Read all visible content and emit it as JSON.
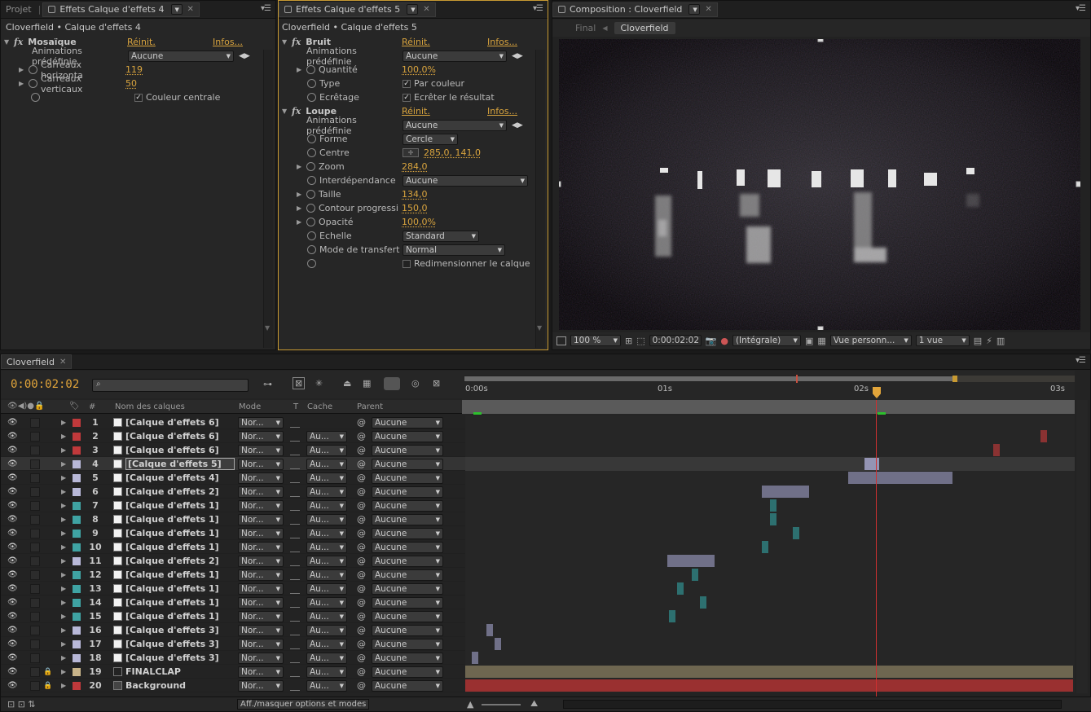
{
  "panel_left": {
    "tab_inactive": "Projet",
    "tab_active": "Effets Calque d'effets 4",
    "breadcrumb": "Cloverfield • Calque d'effets 4",
    "effect": {
      "name": "Mosaïque",
      "reset": "Réinit.",
      "info": "Infos...",
      "props": [
        {
          "label": "Animations prédéfinie",
          "value": "Aucune"
        },
        {
          "label": "Carreaux horizonta",
          "value": "119"
        },
        {
          "label": "Carreaux verticaux",
          "value": "50"
        },
        {
          "label": "",
          "value": "Couleur centrale"
        }
      ]
    }
  },
  "panel_mid": {
    "tab_active": "Effets Calque d'effets 5",
    "breadcrumb": "Cloverfield • Calque d'effets 5",
    "effect1": {
      "name": "Bruit",
      "reset": "Réinit.",
      "info": "Infos...",
      "props": [
        {
          "label": "Animations prédéfinie",
          "value": "Aucune"
        },
        {
          "label": "Quantité",
          "value": "100,0%"
        },
        {
          "label": "Type",
          "value": "Par couleur"
        },
        {
          "label": "Ecrêtage",
          "value": "Ecrêter le résultat"
        }
      ]
    },
    "effect2": {
      "name": "Loupe",
      "reset": "Réinit.",
      "info": "Infos...",
      "props": [
        {
          "label": "Animations prédéfinie",
          "value": "Aucune"
        },
        {
          "label": "Forme",
          "value": "Cercle"
        },
        {
          "label": "Centre",
          "value": "285,0, 141,0"
        },
        {
          "label": "Zoom",
          "value": "284,0"
        },
        {
          "label": "Interdépendance",
          "value": "Aucune"
        },
        {
          "label": "Taille",
          "value": "134,0"
        },
        {
          "label": "Contour progressi",
          "value": "150,0"
        },
        {
          "label": "Opacité",
          "value": "100,0%"
        },
        {
          "label": "Echelle",
          "value": "Standard"
        },
        {
          "label": "Mode de transfert",
          "value": "Normal"
        },
        {
          "label": "",
          "value": "Redimensionner le calque"
        }
      ]
    }
  },
  "comp": {
    "tab": "Composition : Cloverfield",
    "crumb_prev": "Final",
    "crumb_active": "Cloverfield",
    "zoom": "100 %",
    "time": "0:00:02:02",
    "resolution": "(Intégrale)",
    "view": "Vue personn...",
    "views": "1 vue"
  },
  "timeline": {
    "tab": "Cloverfield",
    "timecode": "0:00:02:02",
    "search_placeholder": "",
    "headers": {
      "num": "#",
      "name": "Nom des calques",
      "mode": "Mode",
      "t": "T",
      "cache": "Cache",
      "parent": "Parent"
    },
    "ruler": [
      "0:00s",
      "01s",
      "02s",
      "03s"
    ],
    "footer": "Aff./masquer options et modes",
    "layers": [
      {
        "n": "1",
        "name": "[Calque d'effets 6]",
        "color": "#c0393b",
        "mode": "Nor...",
        "cache": "",
        "parent": "Aucune"
      },
      {
        "n": "2",
        "name": "[Calque d'effets 6]",
        "color": "#c0393b",
        "mode": "Nor...",
        "cache": "Au...",
        "parent": "Aucune"
      },
      {
        "n": "3",
        "name": "[Calque d'effets 6]",
        "color": "#c0393b",
        "mode": "Nor...",
        "cache": "Au...",
        "parent": "Aucune"
      },
      {
        "n": "4",
        "name": "[Calque d'effets 5]",
        "color": "#b8b8d8",
        "mode": "Nor...",
        "cache": "Au...",
        "parent": "Aucune"
      },
      {
        "n": "5",
        "name": "[Calque d'effets 4]",
        "color": "#b8b8d8",
        "mode": "Nor...",
        "cache": "Au...",
        "parent": "Aucune"
      },
      {
        "n": "6",
        "name": "[Calque d'effets 2]",
        "color": "#b8b8d8",
        "mode": "Nor...",
        "cache": "Au...",
        "parent": "Aucune"
      },
      {
        "n": "7",
        "name": "[Calque d'effets 1]",
        "color": "#3fa3a3",
        "mode": "Nor...",
        "cache": "Au...",
        "parent": "Aucune"
      },
      {
        "n": "8",
        "name": "[Calque d'effets 1]",
        "color": "#3fa3a3",
        "mode": "Nor...",
        "cache": "Au...",
        "parent": "Aucune"
      },
      {
        "n": "9",
        "name": "[Calque d'effets 1]",
        "color": "#3fa3a3",
        "mode": "Nor...",
        "cache": "Au...",
        "parent": "Aucune"
      },
      {
        "n": "10",
        "name": "[Calque d'effets 1]",
        "color": "#3fa3a3",
        "mode": "Nor...",
        "cache": "Au...",
        "parent": "Aucune"
      },
      {
        "n": "11",
        "name": "[Calque d'effets 2]",
        "color": "#b8b8d8",
        "mode": "Nor...",
        "cache": "Au...",
        "parent": "Aucune"
      },
      {
        "n": "12",
        "name": "[Calque d'effets 1]",
        "color": "#3fa3a3",
        "mode": "Nor...",
        "cache": "Au...",
        "parent": "Aucune"
      },
      {
        "n": "13",
        "name": "[Calque d'effets 1]",
        "color": "#3fa3a3",
        "mode": "Nor...",
        "cache": "Au...",
        "parent": "Aucune"
      },
      {
        "n": "14",
        "name": "[Calque d'effets 1]",
        "color": "#3fa3a3",
        "mode": "Nor...",
        "cache": "Au...",
        "parent": "Aucune"
      },
      {
        "n": "15",
        "name": "[Calque d'effets 1]",
        "color": "#3fa3a3",
        "mode": "Nor...",
        "cache": "Au...",
        "parent": "Aucune"
      },
      {
        "n": "16",
        "name": "[Calque d'effets 3]",
        "color": "#b8b8d8",
        "mode": "Nor...",
        "cache": "Au...",
        "parent": "Aucune"
      },
      {
        "n": "17",
        "name": "[Calque d'effets 3]",
        "color": "#b8b8d8",
        "mode": "Nor...",
        "cache": "Au...",
        "parent": "Aucune"
      },
      {
        "n": "18",
        "name": "[Calque d'effets 3]",
        "color": "#b8b8d8",
        "mode": "Nor...",
        "cache": "Au...",
        "parent": "Aucune"
      },
      {
        "n": "19",
        "name": "FINALCLAP",
        "color": "#c8b48a",
        "mode": "Nor...",
        "cache": "Au...",
        "parent": "Aucune"
      },
      {
        "n": "20",
        "name": "Background",
        "color": "#c0393b",
        "mode": "Nor...",
        "cache": "Au...",
        "parent": "Aucune"
      }
    ]
  }
}
